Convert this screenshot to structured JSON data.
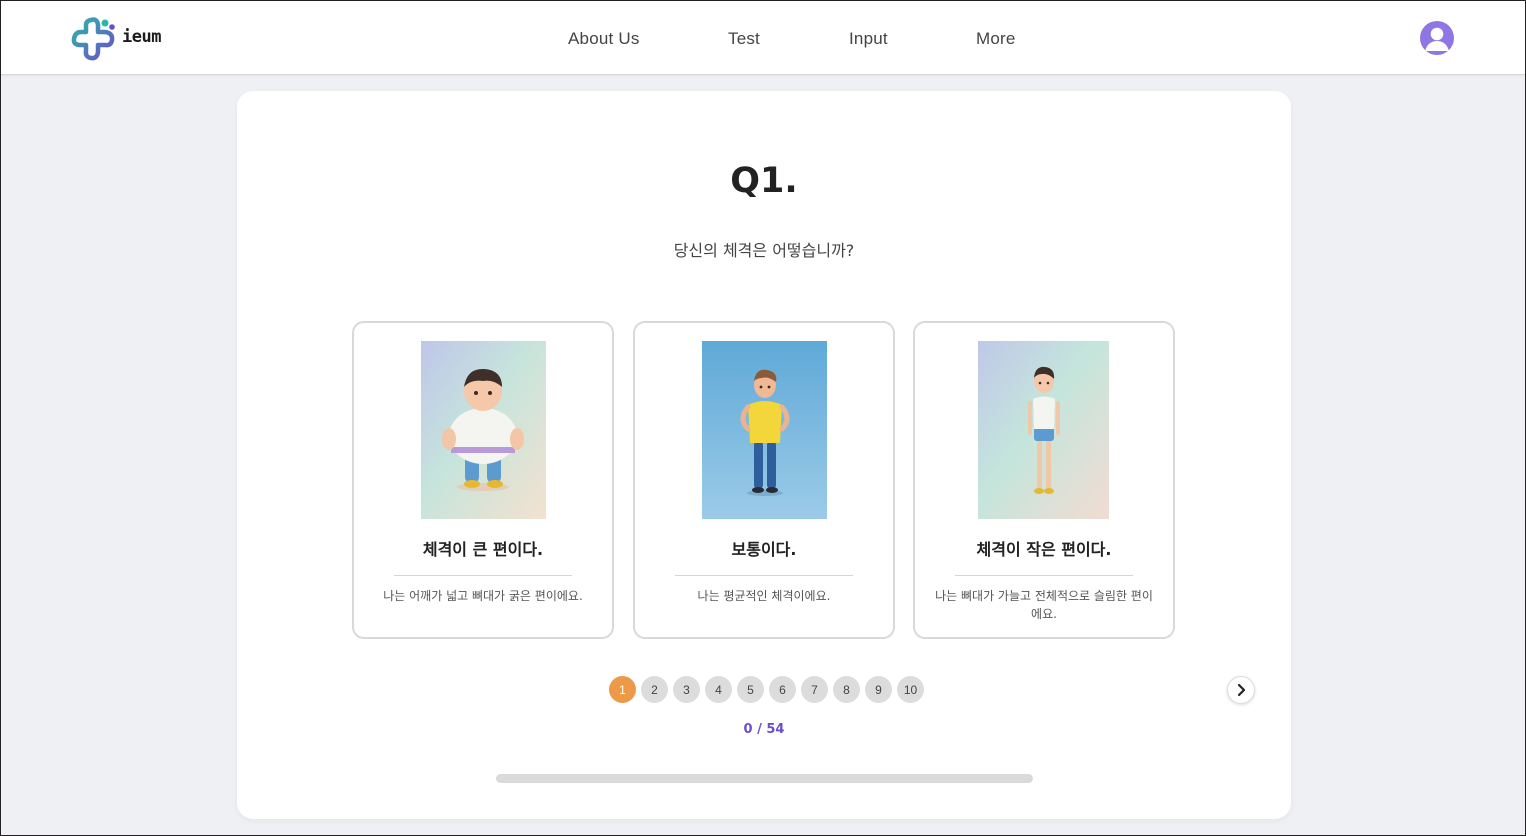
{
  "header": {
    "logo_text": "ieum",
    "nav": [
      "About Us",
      "Test",
      "Input",
      "More"
    ]
  },
  "question": {
    "number": "Q1.",
    "text": "당신의 체격은 어떻습니까?"
  },
  "options": [
    {
      "title": "체격이 큰 편이다.",
      "desc": "나는 어깨가 넓고 뼈대가 굵은 편이에요."
    },
    {
      "title": "보통이다.",
      "desc": "나는 평균적인 체격이에요."
    },
    {
      "title": "체격이 작은 편이다.",
      "desc": "나는 뼈대가 가늘고 전체적으로 슬림한 편이에요."
    }
  ],
  "pagination": {
    "pages": [
      "1",
      "2",
      "3",
      "4",
      "5",
      "6",
      "7",
      "8",
      "9",
      "10"
    ],
    "active": 0
  },
  "progress": {
    "text": "0 / 54",
    "fraction": 0
  },
  "colors": {
    "accent_orange": "#ec9a48",
    "accent_purple": "#6a4fc9",
    "avatar": "#8f76e4"
  },
  "icons": {
    "avatar": "user-avatar-icon",
    "next": "chevron-right-icon"
  }
}
